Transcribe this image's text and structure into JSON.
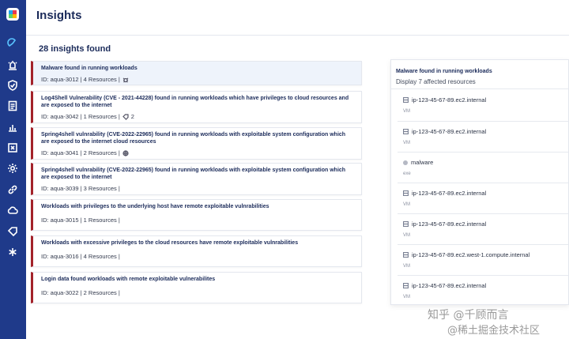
{
  "page": {
    "title": "Insights"
  },
  "insights": {
    "count_label": "28 insights found",
    "items": [
      {
        "title": "Malware found in running workloads",
        "meta": "ID: aqua-3012 | 4 Resources |",
        "icon": "bug-icon"
      },
      {
        "title": "Log4Shell Vulnerability (CVE - 2021-44228) found in running workloads which have privileges to cloud resources and are exposed to the internet",
        "meta": "ID: aqua-3042 | 1 Resources |",
        "icon": "tag-icon",
        "extra": "2"
      },
      {
        "title": "Spring4shell vulnrability (CVE-2022-22965) found in running workloads with exploitable system configuration which are exposed to the internet cloud resources",
        "meta": "ID: aqua-3041 | 2 Resources |",
        "icon": "globe-icon"
      },
      {
        "title": "Spring4shell vulnrability (CVE-2022-22965) found in running workloads with exploitable system configuration which are exposed to the internet",
        "meta": "ID: aqua-3039 | 3 Resources |"
      },
      {
        "title": "Workloads with privileges to the underlying host have remote exploitable vulnrabilities",
        "meta": "ID: aqua-3015 | 1 Resources |"
      },
      {
        "title": "Workloads with excessive privileges to the cloud resources have remote exploitable vulnrabilities",
        "meta": "ID: aqua-3016 | 4 Resources |"
      },
      {
        "title": "Login data found workloads with remote exploitable vulnerabilites",
        "meta": "ID: aqua-3022 | 2 Resources |"
      }
    ]
  },
  "panel": {
    "title": "Malware found in running workloads",
    "subtitle": "Display 7 affected resources",
    "resources": [
      {
        "name": "ip-123-45-67-89.ec2.internal",
        "type": "VM"
      },
      {
        "name": "ip-123-45-67-89.ec2.internal",
        "type": "VM"
      },
      {
        "name": "malware",
        "type": "exe"
      },
      {
        "name": "ip-123-45-67-89.ec2.internal",
        "type": "VM"
      },
      {
        "name": "ip-123-45-67-89.ec2.internal",
        "type": "VM"
      },
      {
        "name": "ip-123-45-67-89.ec2.west-1.compute.internal",
        "type": "VM"
      },
      {
        "name": "ip-123-45-67-89.ec2.internal",
        "type": "VM"
      }
    ]
  },
  "watermark": {
    "line1": "知乎 @千顾而言",
    "line2": "@稀土掘金技术社区"
  },
  "colors": {
    "sidebar": "#1f3a8a",
    "accent": "#a3222a",
    "title": "#1b2b5a"
  }
}
